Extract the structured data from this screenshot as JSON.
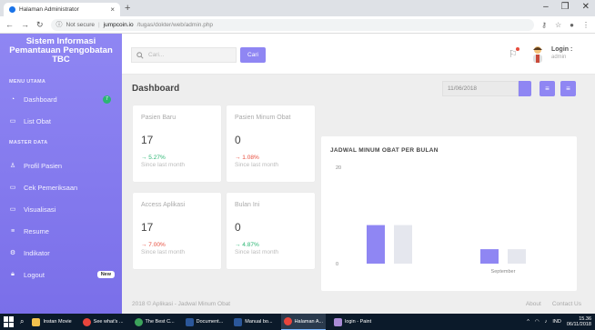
{
  "browser": {
    "tab_title": "Halaman Administrator",
    "close_tab": "×",
    "new_tab": "+",
    "not_secure": "Not secure",
    "url_host": "jumpcoin.io",
    "url_path": "/tugas/dokter/web/admin.php",
    "window_controls": [
      "–",
      "❐",
      "✕"
    ]
  },
  "sidebar": {
    "brand_line1": "Sistem Informasi",
    "brand_line2": "Pemantauan Pengobatan",
    "brand_line3": "TBC",
    "section_menu": "MENU UTAMA",
    "section_master": "MASTER DATA",
    "items": [
      {
        "label": "Dashboard",
        "badge": "7"
      },
      {
        "label": "List Obat"
      },
      {
        "label": "Profil Pasien"
      },
      {
        "label": "Cek Pemeriksaan"
      },
      {
        "label": "Visualisasi"
      },
      {
        "label": "Resume"
      },
      {
        "label": "Indikator"
      },
      {
        "label": "Logout",
        "badge": "New"
      }
    ]
  },
  "topbar": {
    "search_placeholder": "Cari...",
    "search_button": "Cari",
    "login_label": "Login :",
    "login_user": "admin"
  },
  "header": {
    "title": "Dashboard",
    "date": "11/06/2018"
  },
  "stats": [
    {
      "label": "Pasien Baru",
      "value": "17",
      "delta": "→ 5.27%",
      "trend": "up",
      "since": "Since last month"
    },
    {
      "label": "Pasien Minum Obat",
      "value": "0",
      "delta": "→ 1.08%",
      "trend": "down",
      "since": "Since last month"
    },
    {
      "label": "Access Aplikasi",
      "value": "17",
      "delta": "→ 7.00%",
      "trend": "down",
      "since": "Since last month"
    },
    {
      "label": "Bulan Ini",
      "value": "0",
      "delta": "→ 4.87%",
      "trend": "up",
      "since": "Since last month"
    }
  ],
  "chart_data": {
    "type": "bar",
    "title": "JADWAL MINUM OBAT PER BULAN",
    "categories": [
      "",
      "September"
    ],
    "series": [
      {
        "values": [
          8,
          3
        ],
        "color": "#8f86f3"
      },
      {
        "values": [
          8,
          3
        ],
        "color": "#e5e7ee"
      }
    ],
    "ylim": [
      0,
      20
    ],
    "yticks": [
      "20",
      "0"
    ],
    "grid": false
  },
  "footer": {
    "copyright": "2018 © Aplikasi - Jadwal Minum Obat",
    "about": "About",
    "contact": "Contact Us"
  },
  "taskbar": {
    "items": [
      "Instan Movie",
      "See what's ...",
      "The Best C...",
      "Document...",
      "Manual bo...",
      "Halaman A...",
      "login - Paint"
    ],
    "lang": "IND",
    "time": "15.36",
    "date": "06/11/2018"
  }
}
